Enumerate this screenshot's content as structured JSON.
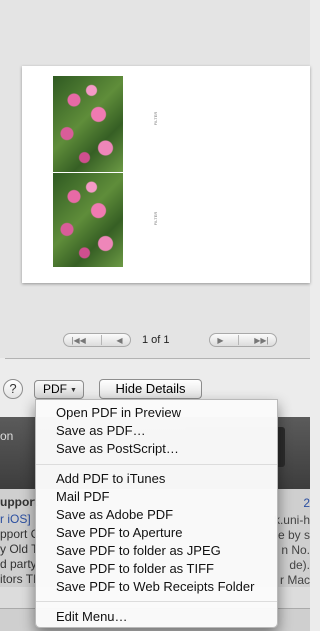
{
  "preview": {
    "page_indicator": "1 of 1",
    "side_caption_top": "FILTER",
    "side_caption_bottom": "FILTER"
  },
  "pager": {
    "first_icon": "first-page-icon",
    "prev_icon": "prev-page-icon",
    "next_icon": "next-page-icon",
    "last_icon": "last-page-icon"
  },
  "controls": {
    "help_label": "?",
    "pdf_label": "PDF",
    "pdf_arrow": "▼",
    "hide_details_label": "Hide Details"
  },
  "menu": {
    "group1": [
      "Open PDF in Preview",
      "Save as PDF…",
      "Save as PostScript…"
    ],
    "group2": [
      "Add PDF to iTunes",
      "Mail PDF",
      "Save as Adobe PDF",
      "Save PDF to Aperture",
      "Save PDF to folder as JPEG",
      "Save PDF to folder as TIFF",
      "Save PDF to Web Receipts Folder"
    ],
    "group3": [
      "Edit Menu…"
    ]
  },
  "background_window": {
    "row_upport": "upport",
    "row_ios": "r iOS]",
    "row_port": "pport C",
    "row_old": "y Old T",
    "row_party": "d party",
    "row_editors": "itors TI",
    "row_on": "on",
    "right_2": "2",
    "right_unih": "k.uni-h",
    "right_e": "e by s",
    "right_no": "n No.",
    "right_de": "de).",
    "right_mac": "r Mac"
  },
  "colors": {
    "menu_bg": "#fafafa",
    "window_bg": "#ececec",
    "accent_flowers": "#e86aa6"
  }
}
